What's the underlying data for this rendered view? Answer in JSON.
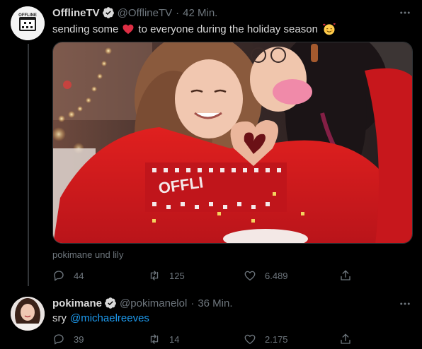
{
  "tweet1": {
    "display_name": "OfflineTV",
    "handle": "@OfflineTV",
    "separator": "·",
    "time": "42 Min.",
    "text_before": "sending some",
    "text_after": "to everyone during the holiday season",
    "emoji_heart": "red-heart",
    "emoji_end": "smiling-face-with-hearts",
    "avatar_label": "OFFLINE",
    "image_text": "OFFLI",
    "caption": "pokimane und lily",
    "stats": {
      "replies": "44",
      "retweets": "125",
      "likes": "6.489"
    }
  },
  "tweet2": {
    "display_name": "pokimane",
    "handle": "@pokimanelol",
    "separator": "·",
    "time": "36 Min.",
    "text": "sry",
    "mention": "@michaelreeves",
    "stats": {
      "replies": "39",
      "retweets": "14",
      "likes": "2.175"
    }
  },
  "colors": {
    "background": "#000000",
    "text": "#d9d9d9",
    "muted": "#6e767d",
    "link": "#1d9bf0",
    "verified": "#d9d9d9"
  },
  "icons": [
    "verified-badge-icon",
    "more-icon",
    "reply-icon",
    "retweet-icon",
    "like-icon",
    "share-icon"
  ]
}
